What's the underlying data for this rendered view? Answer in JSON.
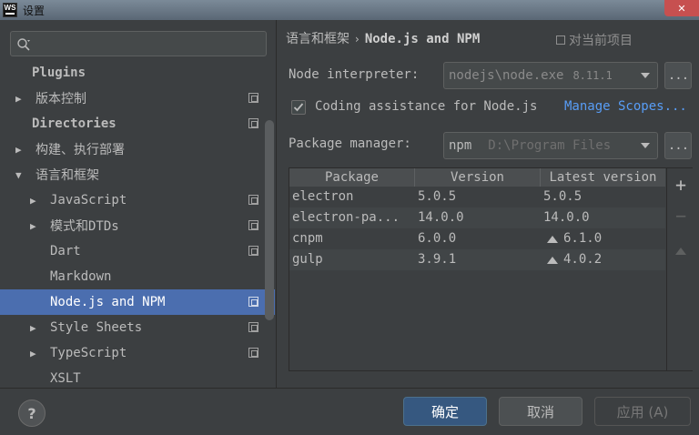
{
  "window": {
    "title": "设置",
    "app_icon_text": "WS"
  },
  "sidebar": {
    "search_placeholder": "",
    "items": [
      {
        "label": "Plugins",
        "bold": true,
        "arrow": "",
        "project_icon": false,
        "indent": 0
      },
      {
        "label": "版本控制",
        "bold": false,
        "arrow": "▶",
        "project_icon": true,
        "indent": 0
      },
      {
        "label": "Directories",
        "bold": true,
        "arrow": "",
        "project_icon": true,
        "indent": 0
      },
      {
        "label": "构建、执行部署",
        "bold": false,
        "arrow": "▶",
        "project_icon": false,
        "indent": 0
      },
      {
        "label": "语言和框架",
        "bold": false,
        "arrow": "▼",
        "project_icon": false,
        "indent": 0
      },
      {
        "label": "JavaScript",
        "bold": false,
        "arrow": "▶",
        "project_icon": true,
        "indent": 1
      },
      {
        "label": "模式和DTDs",
        "bold": false,
        "arrow": "▶",
        "project_icon": true,
        "indent": 1
      },
      {
        "label": "Dart",
        "bold": false,
        "arrow": "",
        "project_icon": true,
        "indent": 1
      },
      {
        "label": "Markdown",
        "bold": false,
        "arrow": "",
        "project_icon": false,
        "indent": 1
      },
      {
        "label": "Node.js and NPM",
        "bold": false,
        "arrow": "",
        "project_icon": true,
        "indent": 1,
        "selected": true
      },
      {
        "label": "Style Sheets",
        "bold": false,
        "arrow": "▶",
        "project_icon": true,
        "indent": 1
      },
      {
        "label": "TypeScript",
        "bold": false,
        "arrow": "▶",
        "project_icon": true,
        "indent": 1
      },
      {
        "label": "XSLT",
        "bold": false,
        "arrow": "",
        "project_icon": false,
        "indent": 1
      }
    ]
  },
  "breadcrumb": {
    "parent": "语言和框架",
    "separator": "›",
    "current": "Node.js and NPM",
    "project_scope": "对当前项目"
  },
  "node_interpreter": {
    "label": "Node interpreter:",
    "value": "nodejs\\node.exe",
    "version": "8.11.1",
    "browse": "..."
  },
  "coding_assistance": {
    "checked": true,
    "label": "Coding assistance for Node.js",
    "manage_link": "Manage Scopes..."
  },
  "package_manager": {
    "label": "Package manager:",
    "value": "npm",
    "path": "D:\\Program Files",
    "browse": "..."
  },
  "packages_table": {
    "headers": [
      "Package",
      "Version",
      "Latest version"
    ],
    "rows": [
      {
        "package": "electron",
        "version": "5.0.5",
        "latest": "5.0.5",
        "upgrade": false
      },
      {
        "package": "electron-pa...",
        "version": "14.0.0",
        "latest": "14.0.0",
        "upgrade": false
      },
      {
        "package": "cnpm",
        "version": "6.0.0",
        "latest": "6.1.0",
        "upgrade": true
      },
      {
        "package": "gulp",
        "version": "3.9.1",
        "latest": "4.0.2",
        "upgrade": true
      }
    ],
    "tools": {
      "add": "+",
      "remove": "−"
    }
  },
  "footer": {
    "help": "?",
    "ok": "确定",
    "cancel": "取消",
    "apply": "应用 (A)"
  },
  "colors": {
    "background": "#3c3f41",
    "selection": "#4b6eaf",
    "link": "#589df6",
    "primary_button": "#365880"
  }
}
